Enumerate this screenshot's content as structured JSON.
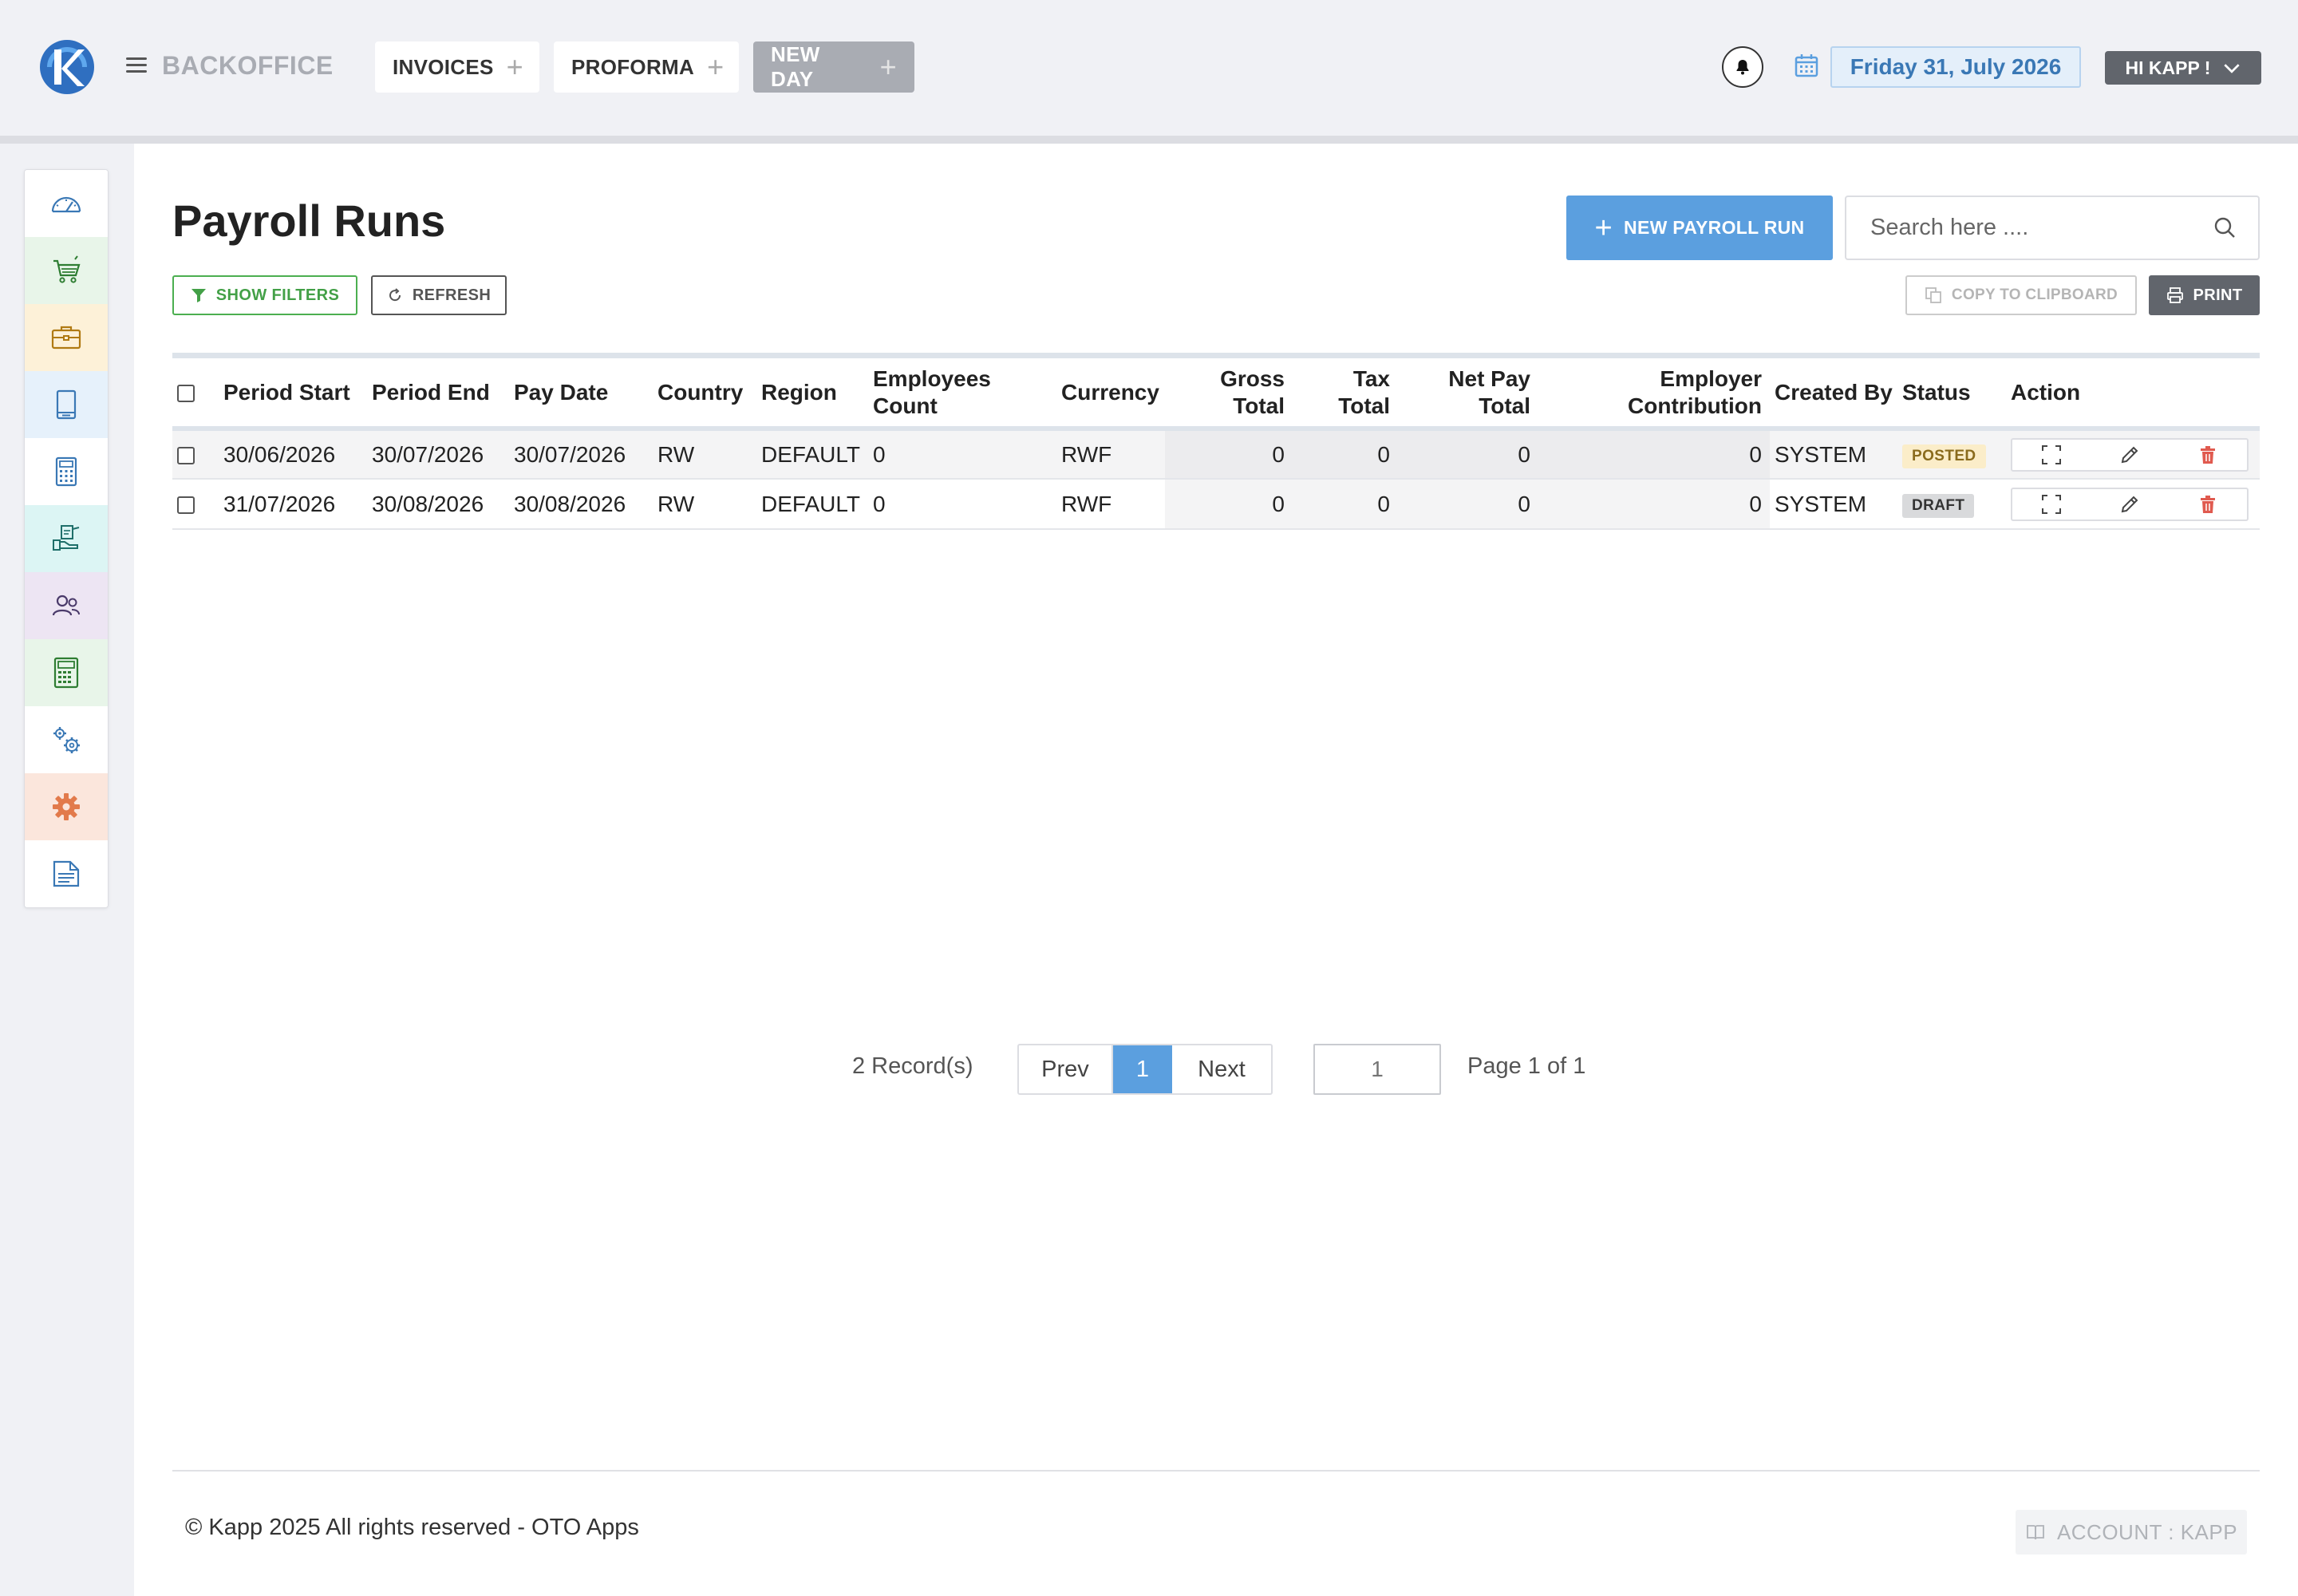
{
  "header": {
    "brand": "BACKOFFICE",
    "tabs": [
      {
        "label": "INVOICES"
      },
      {
        "label": "PROFORMA"
      },
      {
        "label": "NEW DAY"
      }
    ],
    "date": "Friday 31, July 2026",
    "user_greeting": "HI KAPP !"
  },
  "sidebar": {
    "items": [
      {
        "icon": "dashboard-gauge-icon",
        "bg": "#ffffff",
        "color": "#3a78b5"
      },
      {
        "icon": "shopping-cart-icon",
        "bg": "#e8f5e9",
        "color": "#2e7d32"
      },
      {
        "icon": "briefcase-icon",
        "bg": "#fdf1d8",
        "color": "#b07a12"
      },
      {
        "icon": "book-icon",
        "bg": "#e6f1fb",
        "color": "#3a78b5"
      },
      {
        "icon": "calculator-icon",
        "bg": "#ffffff",
        "color": "#3a78b5"
      },
      {
        "icon": "hand-cheque-icon",
        "bg": "#dcf5f4",
        "color": "#1f6f6a"
      },
      {
        "icon": "users-icon",
        "bg": "#ede5f3",
        "color": "#4a3a6a"
      },
      {
        "icon": "accounting-calculator-icon",
        "bg": "#e8f5e9",
        "color": "#2e7d32"
      },
      {
        "icon": "cogs-icon",
        "bg": "#ffffff",
        "color": "#3a78b5"
      },
      {
        "icon": "settings-gear-icon",
        "bg": "#fbe6dc",
        "color": "#e27a4b"
      },
      {
        "icon": "document-file-icon",
        "bg": "#ffffff",
        "color": "#3a78b5"
      }
    ]
  },
  "page": {
    "title": "Payroll Runs",
    "new_button": "NEW PAYROLL RUN",
    "search_placeholder": "Search here ....",
    "show_filters": "SHOW FILTERS",
    "refresh": "REFRESH",
    "copy_clipboard": "COPY TO CLIPBOARD",
    "print": "PRINT"
  },
  "table": {
    "columns": [
      "Period Start",
      "Period End",
      "Pay Date",
      "Country",
      "Region",
      "Employees Count",
      "Currency",
      "Gross Total",
      "Tax Total",
      "Net Pay Total",
      "Employer Contribution",
      "Created By",
      "Status",
      "Action"
    ],
    "rows": [
      {
        "period_start": "30/06/2026",
        "period_end": "30/07/2026",
        "pay_date": "30/07/2026",
        "country": "RW",
        "region": "DEFAULT",
        "employees_count": "0",
        "currency": "RWF",
        "gross_total": "0",
        "tax_total": "0",
        "net_pay_total": "0",
        "employer_contribution": "0",
        "created_by": "SYSTEM",
        "status": "POSTED"
      },
      {
        "period_start": "31/07/2026",
        "period_end": "30/08/2026",
        "pay_date": "30/08/2026",
        "country": "RW",
        "region": "DEFAULT",
        "employees_count": "0",
        "currency": "RWF",
        "gross_total": "0",
        "tax_total": "0",
        "net_pay_total": "0",
        "employer_contribution": "0",
        "created_by": "SYSTEM",
        "status": "DRAFT"
      }
    ]
  },
  "pagination": {
    "records": "2 Record(s)",
    "prev": "Prev",
    "current": "1",
    "next": "Next",
    "page_input_placeholder": "1",
    "page_of": "Page 1 of 1"
  },
  "footer": {
    "copyright": "© Kapp 2025 All rights reserved - OTO Apps",
    "account": "ACCOUNT : KAPP"
  },
  "colors": {
    "accent": "#5b9fdf",
    "green": "#43a047",
    "dark_button": "#61656c",
    "delete_red": "#e05a4f"
  }
}
